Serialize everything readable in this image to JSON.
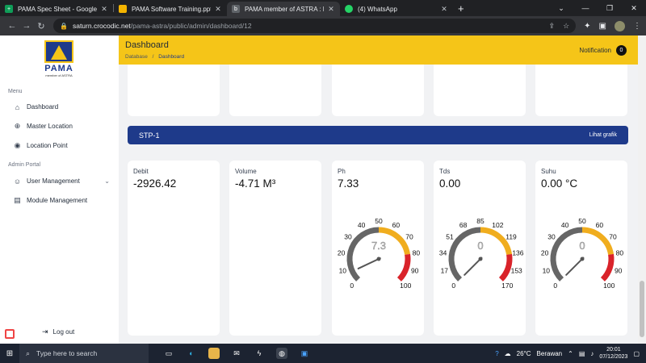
{
  "browser": {
    "tabs": [
      {
        "title": "PAMA Spec Sheet - Google Spre",
        "icon": "sheets-icon",
        "color": "#0f9d58",
        "active": false
      },
      {
        "title": "PAMA Software Training.pptx - G",
        "icon": "slides-icon",
        "color": "#f4b400",
        "active": false
      },
      {
        "title": "PAMA member of ASTRA : Dash",
        "icon": "site-icon",
        "color": "#5f6368",
        "active": true
      },
      {
        "title": "(4) WhatsApp",
        "icon": "whatsapp-icon",
        "color": "#25d366",
        "active": false
      }
    ],
    "url_host": "saturn.crocodic.net",
    "url_path": "/pama-astra/public/admin/dashboard/12"
  },
  "sidebar": {
    "logo_word": "PAMA",
    "logo_sub": "member of ASTRA",
    "menu_title": "Menu",
    "menu_items": [
      {
        "label": "Dashboard",
        "icon": "home-icon"
      },
      {
        "label": "Master Location",
        "icon": "globe-icon"
      },
      {
        "label": "Location Point",
        "icon": "pin-icon"
      }
    ],
    "admin_title": "Admin Portal",
    "admin_items": [
      {
        "label": "User Management",
        "icon": "users-icon"
      },
      {
        "label": "Module Management",
        "icon": "module-icon"
      }
    ],
    "logout_label": "Log out"
  },
  "header": {
    "title": "Dashboard",
    "breadcrumb_root": "Database",
    "breadcrumb_sep": "/",
    "breadcrumb_current": "Dashboard",
    "notification_label": "Notification",
    "notification_count": "0"
  },
  "section": {
    "title": "STP-1",
    "link": "Lihat grafik"
  },
  "metrics": [
    {
      "label": "Debit",
      "value": "-2926.42"
    },
    {
      "label": "Volume",
      "value": "-4.71 M³"
    },
    {
      "label": "Ph",
      "value": "7.33"
    },
    {
      "label": "Tds",
      "value": "0.00"
    },
    {
      "label": "Suhu",
      "value": "0.00 °C"
    }
  ],
  "gauges": [
    {
      "name": "ph-gauge",
      "min": 0,
      "max": 100,
      "value": 7.3,
      "readout": "7.3",
      "ticks": [
        "0",
        "10",
        "20",
        "30",
        "40",
        "50",
        "60",
        "70",
        "80",
        "90",
        "100"
      ]
    },
    {
      "name": "tds-gauge",
      "min": 0,
      "max": 170,
      "value": 0,
      "readout": "0",
      "ticks": [
        "0",
        "17",
        "34",
        "51",
        "68",
        "85",
        "102",
        "119",
        "136",
        "153",
        "170"
      ]
    },
    {
      "name": "suhu-gauge",
      "min": 0,
      "max": 100,
      "value": 0,
      "readout": "0",
      "ticks": [
        "0",
        "10",
        "20",
        "30",
        "40",
        "50",
        "60",
        "70",
        "80",
        "90",
        "100"
      ]
    }
  ],
  "colors": {
    "header": "#f5c518",
    "section_bar": "#1e3a8a",
    "gauge_low": "#666666",
    "gauge_mid": "#f0ad1e",
    "gauge_high": "#d9232a"
  },
  "taskbar": {
    "search_placeholder": "Type here to search",
    "weather_temp": "26°C",
    "weather_text": "Berawan",
    "time": "20:01",
    "date": "07/12/2023"
  }
}
